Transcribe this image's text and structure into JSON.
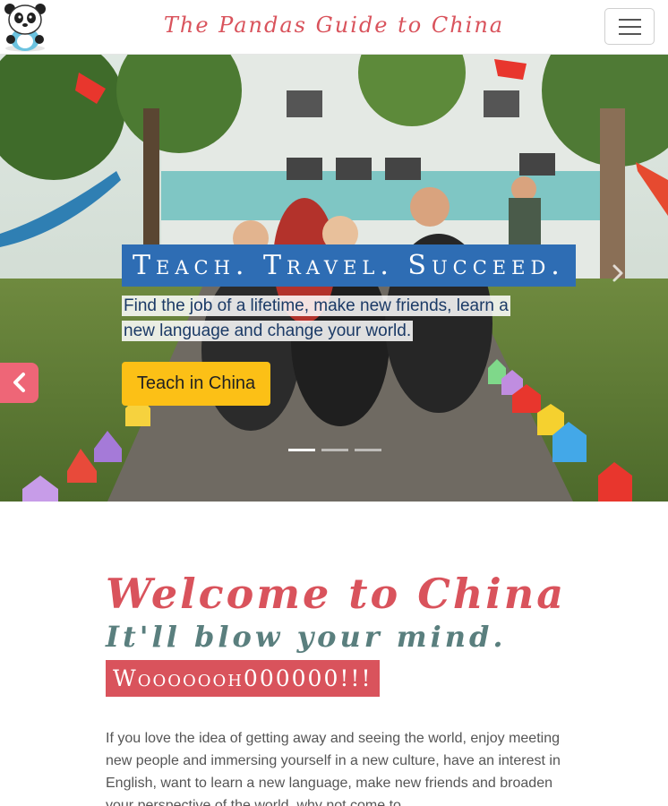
{
  "navbar": {
    "brand": "The Pandas Guide to China",
    "logo_icon": "panda-logo-icon",
    "toggler_icon": "hamburger-menu-icon"
  },
  "hero": {
    "title": "Teach. Travel. Succeed.",
    "text": "Find the job of a lifetime, make new friends, learn a new language and change your world.",
    "button_label": "Teach in China",
    "prev_icon": "chevron-left-icon",
    "next_icon": "chevron-right-icon",
    "slide_count": 3,
    "active_slide": 1
  },
  "welcome": {
    "title": "Welcome to China",
    "subtitle": "It'll blow your mind.",
    "badge": "Wooooooh000000!!!",
    "body": "If you love the idea of getting away and seeing the world, enjoy meeting new people and immersing yourself in a new culture, have an interest in English, want to learn a new language, make new friends and broaden your perspective of the world, why not come to"
  },
  "colors": {
    "brand_red": "#d9535c",
    "caption_blue": "#2e6db4",
    "button_yellow": "#fcc016",
    "subtitle_teal": "#5a7f7e",
    "prev_pink": "#ee6677"
  }
}
